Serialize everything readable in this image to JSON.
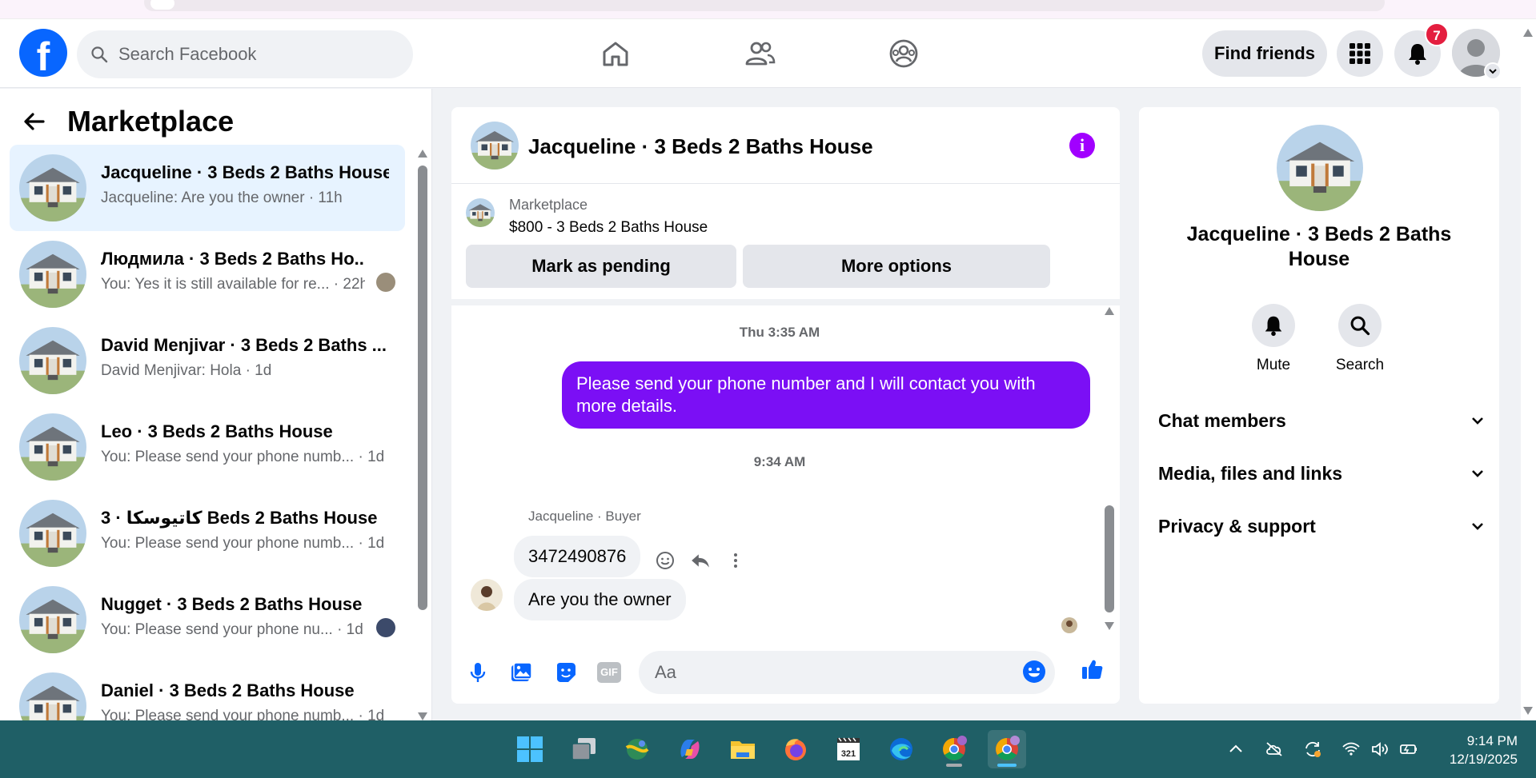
{
  "header": {
    "search_placeholder": "Search Facebook",
    "find_friends_label": "Find friends",
    "notification_count": "7"
  },
  "sidebar": {
    "title": "Marketplace",
    "conversations": [
      {
        "title": "Jacqueline · 3 Beds 2 Baths House",
        "subtitle": "Jacqueline: Are you the owner · 11h",
        "active": true
      },
      {
        "title": "Людмила · 3 Beds 2 Baths Ho...",
        "subtitle": "You: Yes it is still available for re... · 22h"
      },
      {
        "title": "David Menjivar · 3 Beds 2 Baths ...",
        "subtitle": "David Menjivar: Hola · 1d"
      },
      {
        "title": "Leo · 3 Beds 2 Baths House",
        "subtitle": "You: Please send your phone numb... · 1d"
      },
      {
        "title": "كاتيوسكا · 3 Beds 2 Baths House",
        "subtitle": "You: Please send your phone numb... · 1d"
      },
      {
        "title": "Nugget · 3 Beds 2 Baths House",
        "subtitle": "You: Please send your phone nu... · 1d"
      },
      {
        "title": "Daniel · 3 Beds 2 Baths House",
        "subtitle": "You: Please send your phone numb... · 1d"
      }
    ]
  },
  "chat": {
    "title": "Jacqueline · 3 Beds 2 Baths House",
    "listing_label": "Marketplace",
    "listing_price": "$800 - 3 Beds 2 Baths House",
    "mark_pending_label": "Mark as pending",
    "more_options_label": "More options",
    "timestamp_1": "Thu 3:35 AM",
    "outgoing_message": "Please send your phone number and I will contact you with more details.",
    "timestamp_2": "9:34 AM",
    "sender_label": "Jacqueline · Buyer",
    "incoming_1": "3472490876",
    "incoming_2": "Are you the owner",
    "composer_placeholder": "Aa",
    "gif_label": "GIF"
  },
  "details": {
    "title": "Jacqueline · 3 Beds 2 Baths House",
    "mute_label": "Mute",
    "search_label": "Search",
    "sections": [
      "Chat members",
      "Media, files and links",
      "Privacy & support"
    ]
  },
  "taskbar": {
    "time": "9:14 PM",
    "date": "12/19/2025",
    "calendar_badge": "321"
  },
  "colors": {
    "brand_blue": "#0866ff",
    "outgoing_bubble": "#7b0ff5",
    "info_purple": "#a100ff",
    "active_row": "#e7f3ff",
    "taskbar": "#1f5f66"
  }
}
